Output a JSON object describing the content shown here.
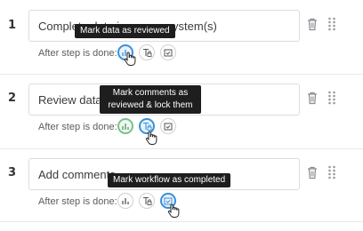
{
  "after_step_label": "After step is done:",
  "steps": [
    {
      "number": "1",
      "text": "Complete data in source system(s)",
      "active_action": "mark-data-reviewed",
      "tooltip": "Mark data as reviewed"
    },
    {
      "number": "2",
      "text": "Review data",
      "active_action": "mark-comments-reviewed-lock",
      "tooltip": "Mark comments as reviewed & lock them"
    },
    {
      "number": "3",
      "text": "Add comments",
      "active_action": "mark-workflow-completed",
      "tooltip": "Mark workflow as completed"
    }
  ],
  "action_icons": [
    "bar-chart-icon",
    "lock-comment-icon",
    "calendar-check-icon"
  ],
  "colors": {
    "active_blue": "#3a8fd8",
    "active_green": "#7cbf8c",
    "tooltip_bg": "#1e1e1e"
  }
}
